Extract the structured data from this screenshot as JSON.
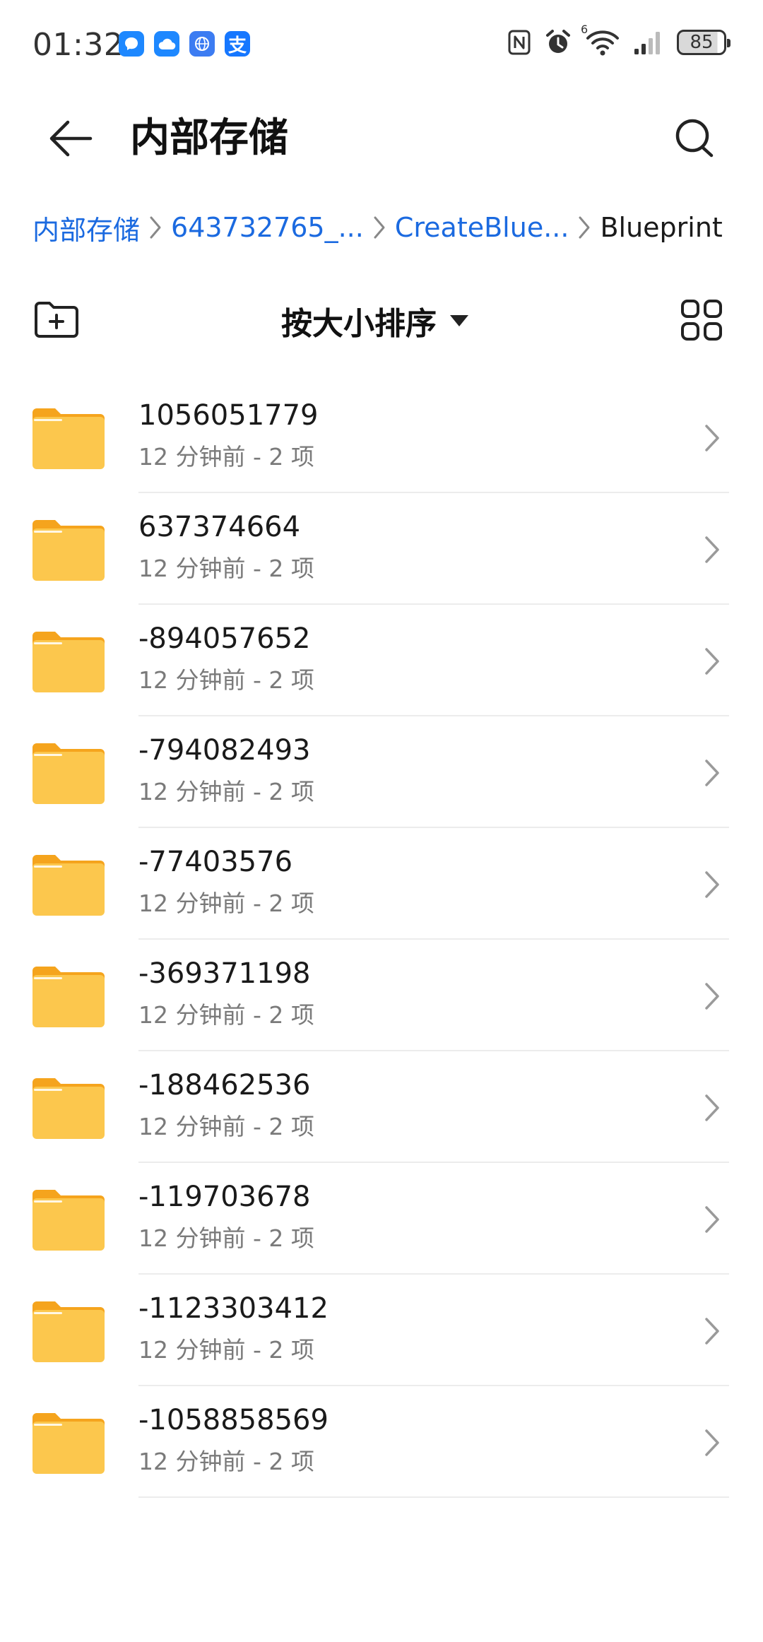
{
  "status_bar": {
    "time": "01:32",
    "battery": "85",
    "app_badges": [
      "message-icon",
      "cloud-icon",
      "browser-icon",
      "alipay-icon"
    ],
    "alipay_glyph": "支",
    "network_label": "6"
  },
  "header": {
    "title": "内部存储"
  },
  "breadcrumb": [
    "内部存储",
    "643732765_...",
    "CreateBlue...",
    "Blueprint"
  ],
  "toolbar": {
    "sort_label": "按大小排序"
  },
  "folders": [
    {
      "name": "1056051779",
      "meta": "12 分钟前 - 2 项"
    },
    {
      "name": "637374664",
      "meta": "12 分钟前 - 2 项"
    },
    {
      "name": "-894057652",
      "meta": "12 分钟前 - 2 项"
    },
    {
      "name": "-794082493",
      "meta": "12 分钟前 - 2 项"
    },
    {
      "name": "-77403576",
      "meta": "12 分钟前 - 2 项"
    },
    {
      "name": "-369371198",
      "meta": "12 分钟前 - 2 项"
    },
    {
      "name": "-188462536",
      "meta": "12 分钟前 - 2 项"
    },
    {
      "name": "-119703678",
      "meta": "12 分钟前 - 2 项"
    },
    {
      "name": "-1123303412",
      "meta": "12 分钟前 - 2 项"
    },
    {
      "name": "-1058858569",
      "meta": "12 分钟前 - 2 项"
    }
  ],
  "colors": {
    "link": "#1b6ae0",
    "folder": "#fcc74d",
    "folder_tab": "#f5a41d"
  }
}
